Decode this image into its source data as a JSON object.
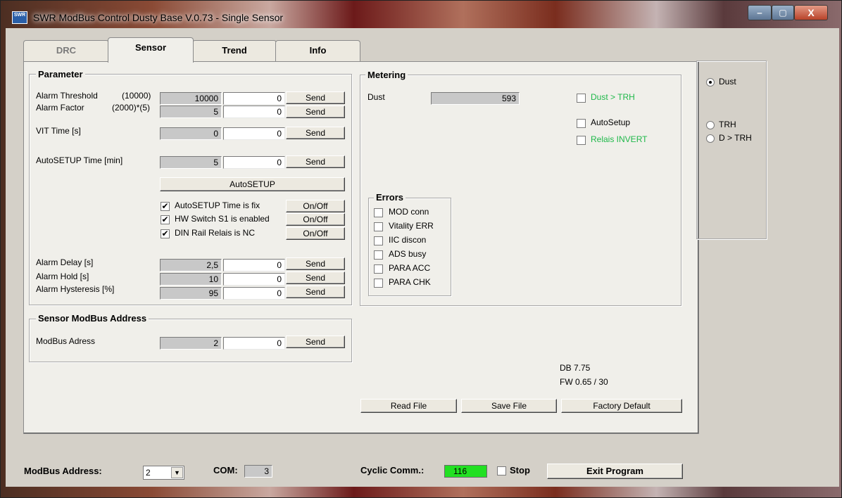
{
  "window": {
    "title": "SWR ModBus Control Dusty Base V.0.73 - Single Sensor",
    "icon_text": "SWR",
    "min_glyph": "‒",
    "max_glyph": "▢",
    "close_glyph": "X"
  },
  "tabs": [
    {
      "label": "DRC"
    },
    {
      "label": "Sensor"
    },
    {
      "label": "Trend"
    },
    {
      "label": "Info"
    }
  ],
  "parameter": {
    "title": "Parameter",
    "rows": [
      {
        "label": "Alarm Threshold",
        "hint": "(10000)",
        "current": "10000",
        "input": "0",
        "button": "Send"
      },
      {
        "label": "Alarm Factor",
        "hint": "(2000)*(5)",
        "current": "5",
        "input": "0",
        "button": "Send"
      },
      {
        "label": "VIT Time [s]",
        "hint": "",
        "current": "0",
        "input": "0",
        "button": "Send"
      },
      {
        "label": "AutoSETUP Time [min]",
        "hint": "",
        "current": "5",
        "input": "0",
        "button": "Send"
      }
    ],
    "autosetup_button": "AutoSETUP",
    "toggles": [
      {
        "label": "AutoSETUP Time is fix",
        "checked": "✔",
        "button": "On/Off"
      },
      {
        "label": "HW Switch S1 is enabled",
        "checked": "✔",
        "button": "On/Off"
      },
      {
        "label": "DIN Rail Relais is NC",
        "checked": "✔",
        "button": "On/Off"
      }
    ],
    "alarm_rows": [
      {
        "label": "Alarm Delay [s]",
        "current": "2,5",
        "input": "0",
        "button": "Send"
      },
      {
        "label": "Alarm Hold [s]",
        "current": "10",
        "input": "0",
        "button": "Send"
      },
      {
        "label": "Alarm Hysteresis [%]",
        "current": "95",
        "input": "0",
        "button": "Send"
      }
    ]
  },
  "modbus_group": {
    "title": "Sensor ModBus Address",
    "label": "ModBus Adress",
    "current": "2",
    "input": "0",
    "button": "Send"
  },
  "metering": {
    "title": "Metering",
    "dust_label": "Dust",
    "dust_value": "593",
    "checks": [
      {
        "label": "Dust > TRH",
        "color": "#1fb84a"
      },
      {
        "label": "AutoSetup",
        "color": "#000000"
      },
      {
        "label": "Relais INVERT",
        "color": "#1fb84a"
      }
    ]
  },
  "errors": {
    "title": "Errors",
    "items": [
      "MOD conn",
      "Vitality ERR",
      "IIC discon",
      "ADS busy",
      "PARA ACC",
      "PARA CHK"
    ]
  },
  "versions": {
    "db": "DB 7.75",
    "fw": "FW 0.65 / 30"
  },
  "file_buttons": {
    "read": "Read File",
    "save": "Save File",
    "factory": "Factory Default"
  },
  "trend_select": {
    "options": [
      {
        "label": "Dust",
        "selected": true
      },
      {
        "label": "TRH",
        "selected": false
      },
      {
        "label": "D > TRH",
        "selected": false
      }
    ]
  },
  "bottom": {
    "modbus_label": "ModBus Address:",
    "modbus_value": "2",
    "com_label": "COM:",
    "com_value": "3",
    "cyclic_label": "Cyclic Comm.:",
    "cyclic_value": "116",
    "cyclic_color": "#22e022",
    "stop_label": "Stop",
    "exit_button": "Exit Program"
  }
}
